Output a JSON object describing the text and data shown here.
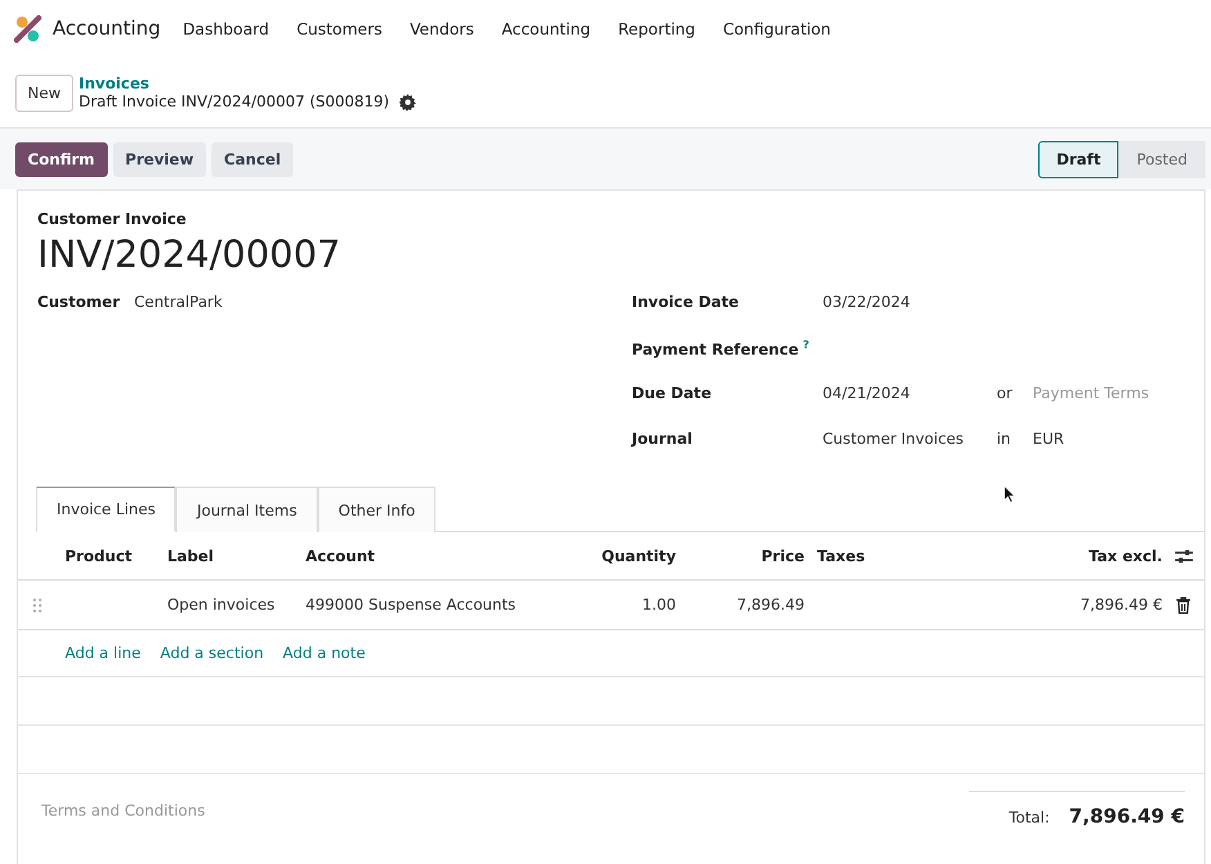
{
  "nav": {
    "app_name": "Accounting",
    "menu": [
      "Dashboard",
      "Customers",
      "Vendors",
      "Accounting",
      "Reporting",
      "Configuration"
    ]
  },
  "control": {
    "new_button": "New",
    "breadcrumb_parent": "Invoices",
    "breadcrumb_current": "Draft Invoice INV/2024/00007 (S000819)"
  },
  "actions": [
    {
      "label": "Confirm",
      "kind": "primary"
    },
    {
      "label": "Preview",
      "kind": "secondary"
    },
    {
      "label": "Cancel",
      "kind": "secondary"
    }
  ],
  "stages": [
    {
      "label": "Draft",
      "selected": true
    },
    {
      "label": "Posted",
      "selected": false
    }
  ],
  "sheet": {
    "type_label": "Customer Invoice",
    "number": "INV/2024/00007",
    "customer_label": "Customer",
    "customer": "CentralPark",
    "fields": [
      {
        "label": "Invoice Date",
        "value": "03/22/2024"
      },
      {
        "label": "Payment Reference",
        "help": "?"
      },
      {
        "label": "Due Date",
        "value": "04/21/2024",
        "connector": "or",
        "placeholder": "Payment Terms"
      },
      {
        "label": "Journal",
        "value": "Customer Invoices",
        "connector": "in",
        "extra": "EUR"
      }
    ]
  },
  "tabs": [
    {
      "label": "Invoice Lines",
      "selected": true
    },
    {
      "label": "Journal Items",
      "selected": false
    },
    {
      "label": "Other Info",
      "selected": false
    }
  ],
  "table": {
    "columns": [
      {
        "label": "Product",
        "kind": "text"
      },
      {
        "label": "Label",
        "kind": "text"
      },
      {
        "label": "Account",
        "kind": "text"
      },
      {
        "label": "Quantity",
        "kind": "number"
      },
      {
        "label": "Price",
        "kind": "number"
      },
      {
        "label": "Taxes",
        "kind": "text"
      },
      {
        "label": "Tax excl.",
        "kind": "number"
      }
    ],
    "rows": [
      {
        "cells": [
          null,
          "Open invoices",
          "499000 Suspense Accounts",
          "1.00",
          "7,896.49",
          null,
          "7,896.49 €"
        ]
      }
    ],
    "add_links": [
      "Add a line",
      "Add a section",
      "Add a note"
    ]
  },
  "footer": {
    "terms_placeholder": "Terms and Conditions",
    "total_label": "Total:",
    "total": "7,896.49 €"
  }
}
